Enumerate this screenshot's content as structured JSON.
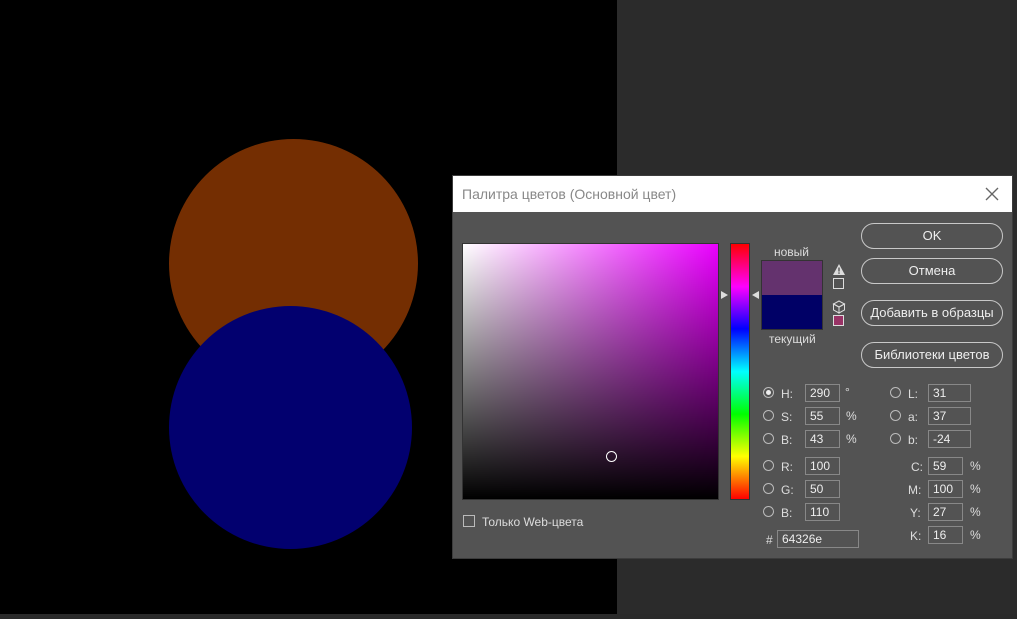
{
  "dialog": {
    "title": "Палитра цветов (Основной цвет)",
    "labels": {
      "new": "новый",
      "current": "текущий"
    },
    "colors": {
      "new": "#64326e",
      "current": "#000066"
    },
    "buttons": {
      "ok": "OK",
      "cancel": "Отмена",
      "add_to_swatches": "Добавить в образцы",
      "color_libraries": "Библиотеки цветов"
    },
    "hsb": {
      "h": {
        "label": "H:",
        "value": "290",
        "unit": "°"
      },
      "s": {
        "label": "S:",
        "value": "55",
        "unit": "%"
      },
      "b": {
        "label": "B:",
        "value": "43",
        "unit": "%"
      }
    },
    "rgb": {
      "r": {
        "label": "R:",
        "value": "100"
      },
      "g": {
        "label": "G:",
        "value": "50"
      },
      "b": {
        "label": "B:",
        "value": "110"
      }
    },
    "lab": {
      "l": {
        "label": "L:",
        "value": "31"
      },
      "a": {
        "label": "a:",
        "value": "37"
      },
      "b": {
        "label": "b:",
        "value": "-24"
      }
    },
    "cmyk": {
      "c": {
        "label": "C:",
        "value": "59",
        "unit": "%"
      },
      "m": {
        "label": "M:",
        "value": "100",
        "unit": "%"
      },
      "y": {
        "label": "Y:",
        "value": "27",
        "unit": "%"
      },
      "k": {
        "label": "K:",
        "value": "16",
        "unit": "%"
      }
    },
    "hex": {
      "label": "#",
      "value": "64326e"
    },
    "web_only_label": "Только Web-цвета"
  },
  "icons": {
    "close": "close-icon",
    "gamut_warning": "warning-icon",
    "web_safe": "cube-icon"
  }
}
